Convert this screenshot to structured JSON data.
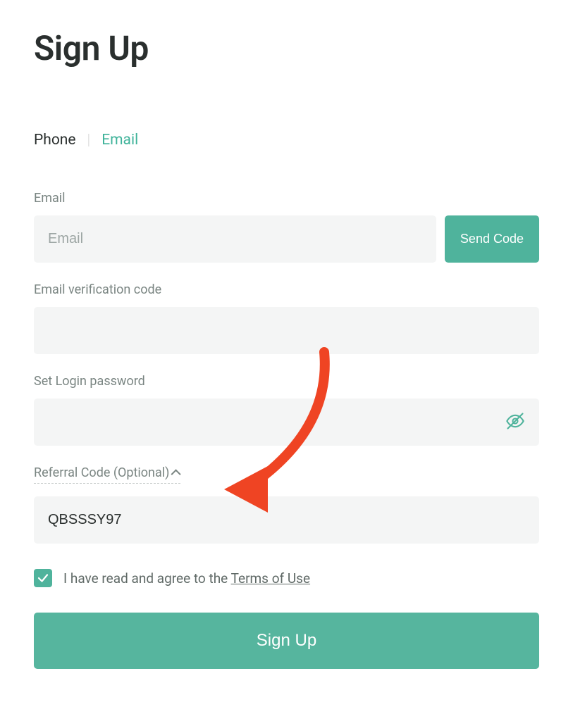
{
  "title": "Sign Up",
  "tabs": {
    "phone": "Phone",
    "email": "Email"
  },
  "fields": {
    "email": {
      "label": "Email",
      "placeholder": "Email",
      "value": ""
    },
    "send_code_label": "Send Code",
    "verification": {
      "label": "Email verification code",
      "value": ""
    },
    "password": {
      "label": "Set Login password",
      "value": ""
    },
    "referral": {
      "toggle_label": "Referral Code (Optional)",
      "value": "QBSSSY97"
    }
  },
  "terms": {
    "checked": true,
    "prefix": "I have read and agree to the ",
    "link": "Terms of Use"
  },
  "submit_label": "Sign Up"
}
